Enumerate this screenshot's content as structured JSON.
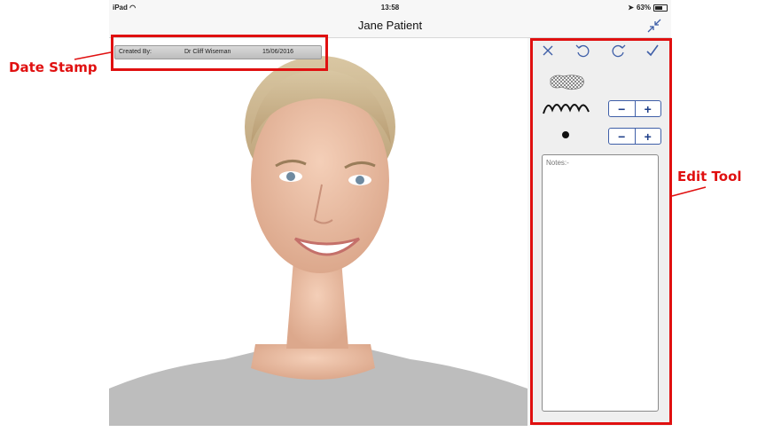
{
  "status_bar": {
    "device": "iPad",
    "time": "13:58",
    "battery": "63%"
  },
  "navbar": {
    "title": "Jane Patient"
  },
  "date_stamp": {
    "created_by_label": "Created By:",
    "doctor": "Dr Cliff Wiseman",
    "date": "15/06/2016"
  },
  "edit_tool": {
    "notes_placeholder": "Notes:-",
    "stepper_minus": "−",
    "stepper_plus": "+"
  },
  "annotations": {
    "date_stamp": "Date Stamp",
    "edit_tool": "Edit Tool"
  },
  "colors": {
    "annotation": "#e01010",
    "accent": "#1f3f8a"
  }
}
